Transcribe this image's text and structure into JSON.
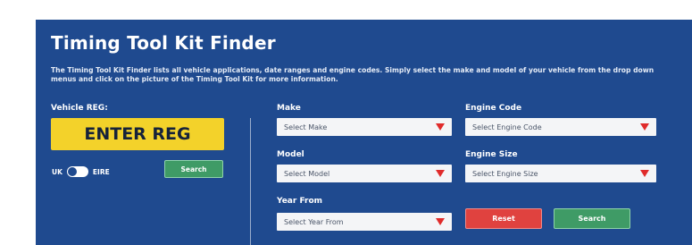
{
  "title": "Timing Tool Kit Finder",
  "description": "The Timing Tool Kit Finder lists all vehicle applications, date ranges and engine codes. Simply select the make and model of your vehicle from the drop down menus and click on the picture of the Timing Tool Kit for more information.",
  "reg": {
    "label": "Vehicle REG:",
    "enter_button": "ENTER REG",
    "toggle_left": "UK",
    "toggle_right": "EIRE",
    "search_button": "Search"
  },
  "filters": {
    "make_label": "Make",
    "make_value": "Select Make",
    "engine_code_label": "Engine Code",
    "engine_code_value": "Select Engine Code",
    "model_label": "Model",
    "model_value": "Select Model",
    "engine_size_label": "Engine Size",
    "engine_size_value": "Select Engine Size",
    "year_label": "Year From",
    "year_value": "Select Year From",
    "reset_button": "Reset",
    "search_button": "Search"
  },
  "colors": {
    "panel": "#1f4a8f",
    "reg_yellow": "#f3d22a",
    "reset_red": "#e0423f",
    "search_green": "#3f9b66",
    "caret_red": "#e02b2b"
  }
}
